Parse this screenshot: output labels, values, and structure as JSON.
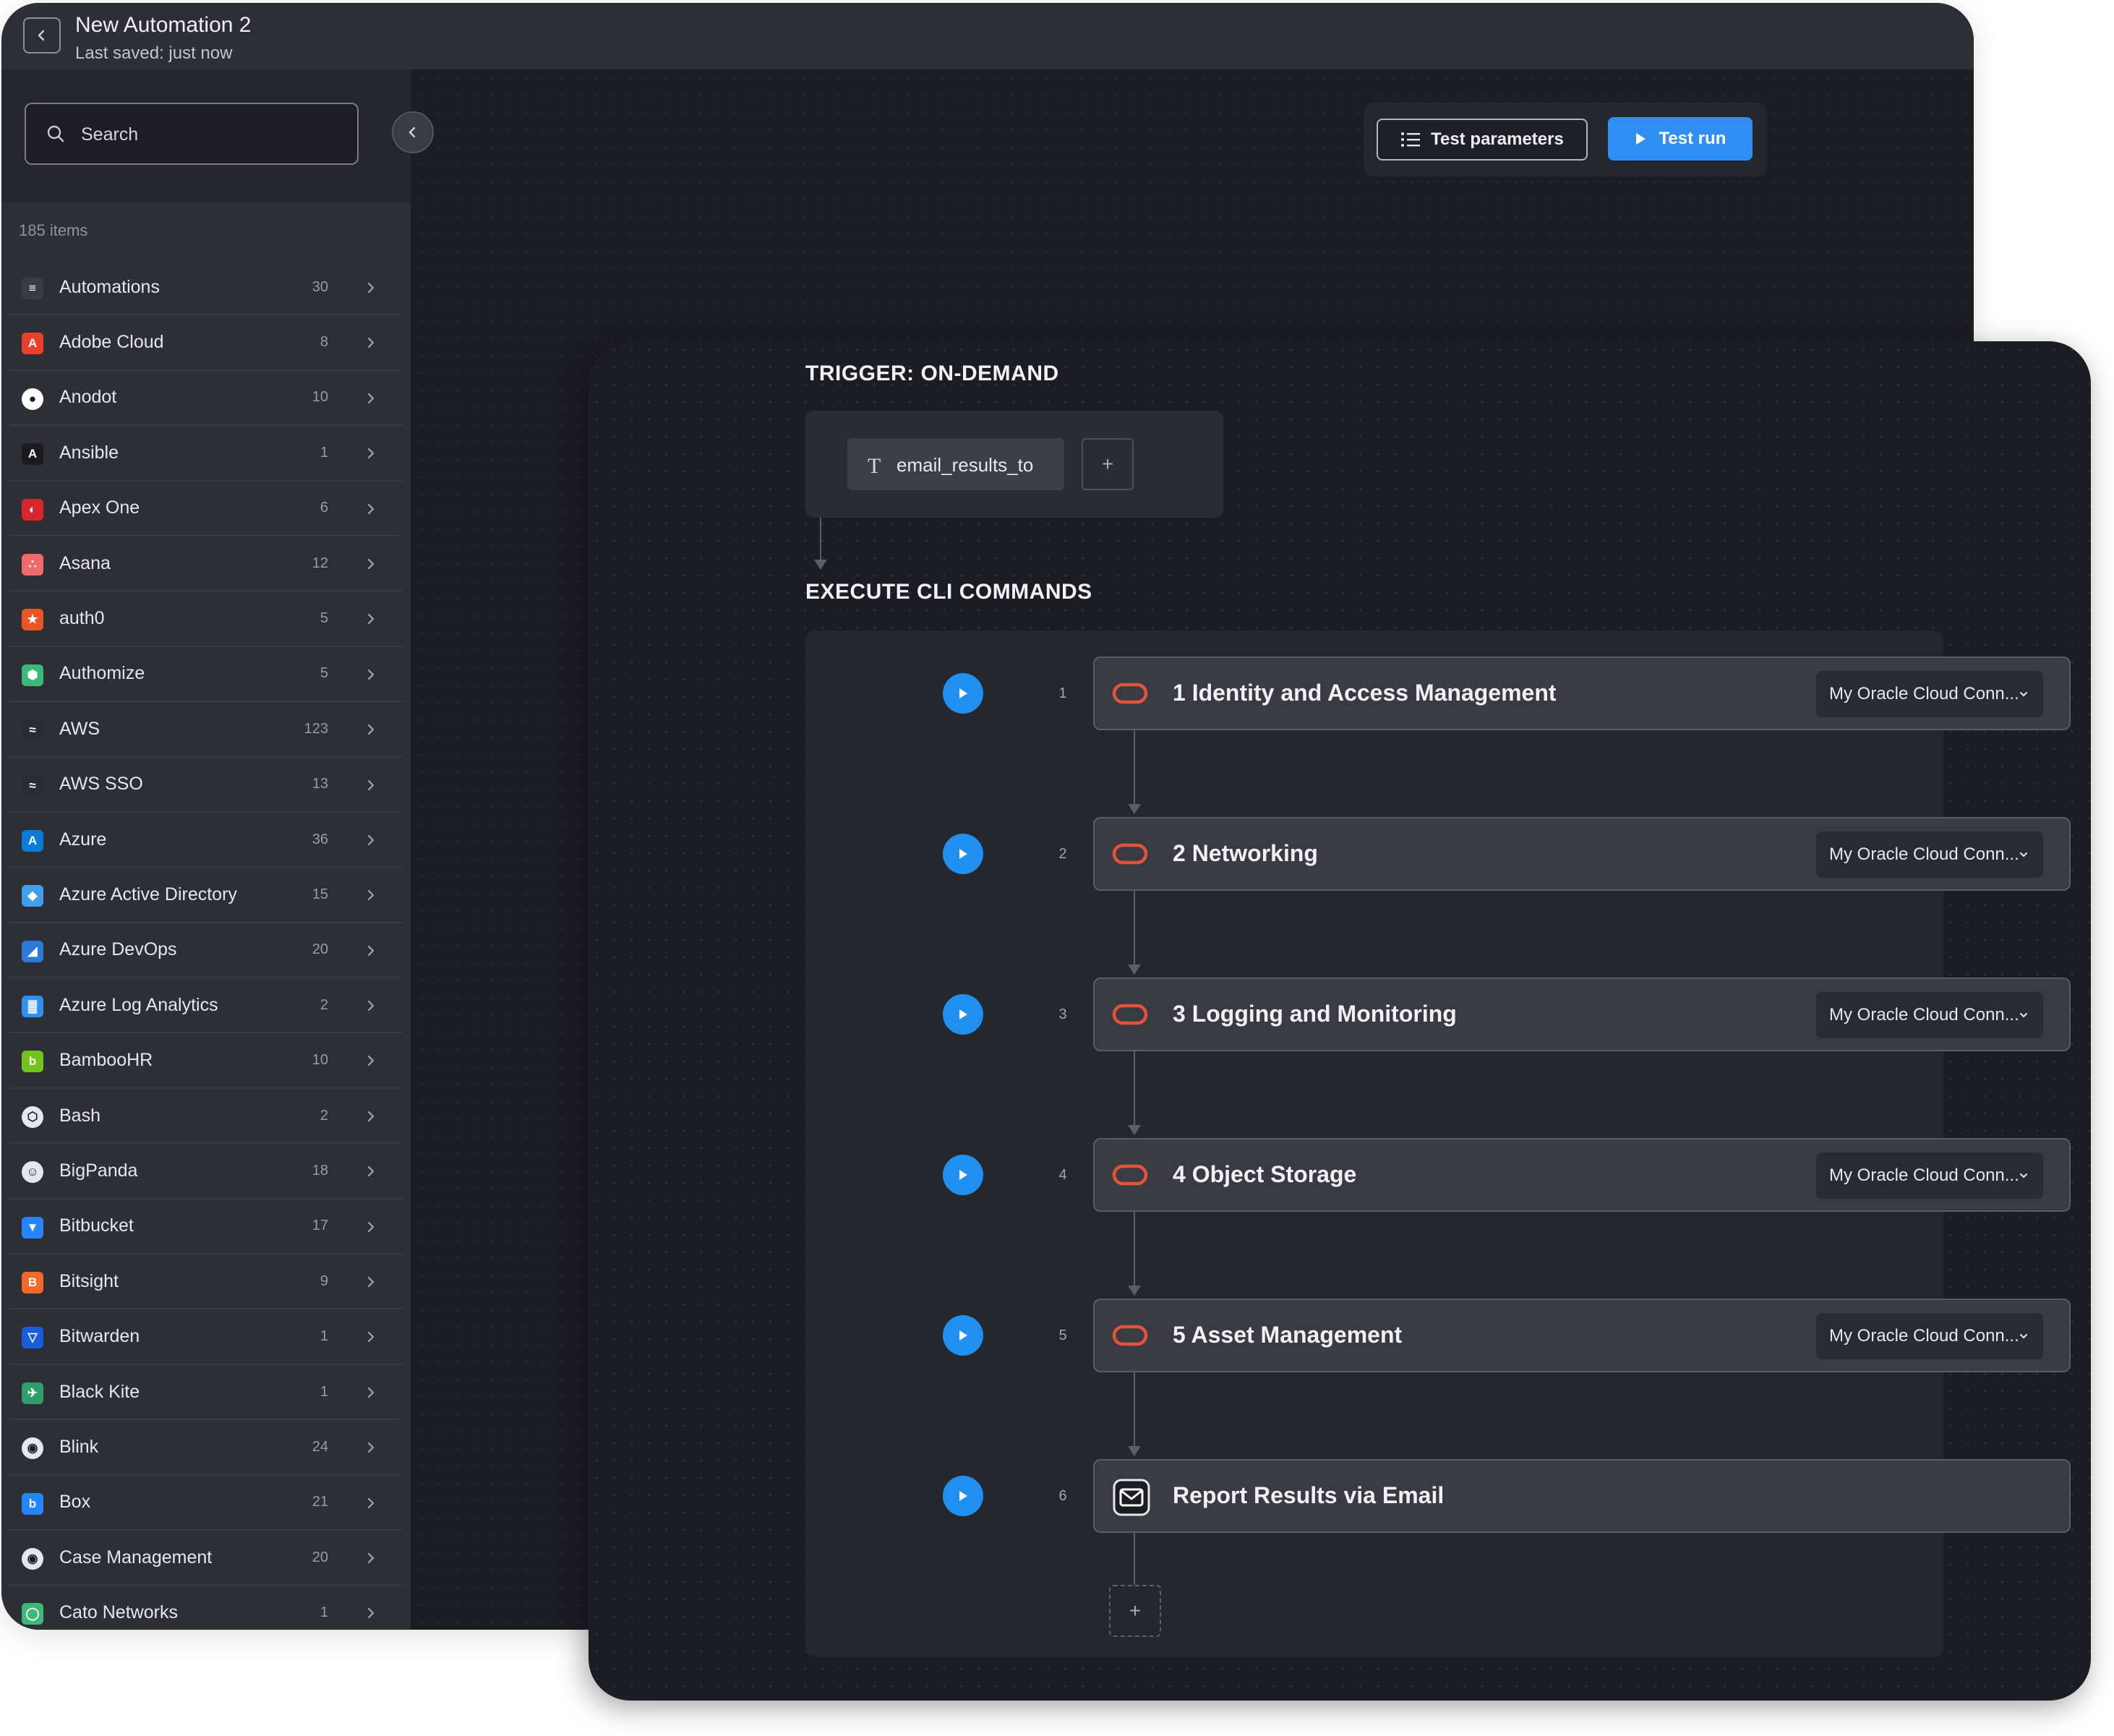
{
  "window": {
    "title": "New Automation 2",
    "save_status": "Last saved: just now"
  },
  "sidebar": {
    "search_placeholder": "Search",
    "items_count": "185 items",
    "items": [
      {
        "label": "Automations",
        "count": "30",
        "icon": "automations-icon",
        "color": "#3a3a42"
      },
      {
        "label": "Adobe Cloud",
        "count": "8",
        "icon": "adobe-cloud-icon",
        "color": "#e8412b"
      },
      {
        "label": "Anodot",
        "count": "10",
        "icon": "anodot-icon",
        "color": "#ffffff"
      },
      {
        "label": "Ansible",
        "count": "1",
        "icon": "ansible-icon",
        "color": "#1b1b1f"
      },
      {
        "label": "Apex One",
        "count": "6",
        "icon": "apex-one-icon",
        "color": "#d8262e"
      },
      {
        "label": "Asana",
        "count": "12",
        "icon": "asana-icon",
        "color": "#f06a6a"
      },
      {
        "label": "auth0",
        "count": "5",
        "icon": "auth0-icon",
        "color": "#eb5424"
      },
      {
        "label": "Authomize",
        "count": "5",
        "icon": "authomize-icon",
        "color": "#3cb878"
      },
      {
        "label": "AWS",
        "count": "123",
        "icon": "aws-icon",
        "color": "#2b2b33"
      },
      {
        "label": "AWS SSO",
        "count": "13",
        "icon": "aws-sso-icon",
        "color": "#2b2b33"
      },
      {
        "label": "Azure",
        "count": "36",
        "icon": "azure-icon",
        "color": "#0a7bd7"
      },
      {
        "label": "Azure Active Directory",
        "count": "15",
        "icon": "azure-active-directory-icon",
        "color": "#3ea0ec"
      },
      {
        "label": "Azure DevOps",
        "count": "20",
        "icon": "azure-devops-icon",
        "color": "#2a7ad8"
      },
      {
        "label": "Azure Log Analytics",
        "count": "2",
        "icon": "azure-log-analytics-icon",
        "color": "#2f8ff2"
      },
      {
        "label": "BambooHR",
        "count": "10",
        "icon": "bamboohr-icon",
        "color": "#73c41d"
      },
      {
        "label": "Bash",
        "count": "2",
        "icon": "bash-icon",
        "color": "#e6e7ec"
      },
      {
        "label": "BigPanda",
        "count": "18",
        "icon": "bigpanda-icon",
        "color": "#e6e7ec"
      },
      {
        "label": "Bitbucket",
        "count": "17",
        "icon": "bitbucket-icon",
        "color": "#2684ff"
      },
      {
        "label": "Bitsight",
        "count": "9",
        "icon": "bitsight-icon",
        "color": "#f26a2a"
      },
      {
        "label": "Bitwarden",
        "count": "1",
        "icon": "bitwarden-icon",
        "color": "#175ddc"
      },
      {
        "label": "Black Kite",
        "count": "1",
        "icon": "black-kite-icon",
        "color": "#2f9e6a"
      },
      {
        "label": "Blink",
        "count": "24",
        "icon": "blink-icon",
        "color": "#e6e7ec"
      },
      {
        "label": "Box",
        "count": "21",
        "icon": "box-icon",
        "color": "#2486fc"
      },
      {
        "label": "Case Management",
        "count": "20",
        "icon": "case-management-icon",
        "color": "#e6e7ec"
      },
      {
        "label": "Cato Networks",
        "count": "1",
        "icon": "cato-networks-icon",
        "color": "#3cb878"
      }
    ]
  },
  "toolbar": {
    "test_parameters_label": "Test parameters",
    "test_run_label": "Test run",
    "accent_color": "#2f8ff2"
  },
  "trigger": {
    "title": "TRIGGER: ON-DEMAND",
    "param_type_icon": "T",
    "param_label": "email_results_to",
    "add_label": "+"
  },
  "execute": {
    "title": "EXECUTE CLI COMMANDS",
    "add_label": "+",
    "steps": [
      {
        "number": "1",
        "title": "1 Identity and Access Management",
        "connection": "My Oracle Cloud Conn...",
        "icon": "oracle-icon"
      },
      {
        "number": "2",
        "title": "2 Networking",
        "connection": "My Oracle Cloud Conn...",
        "icon": "oracle-icon"
      },
      {
        "number": "3",
        "title": "3 Logging and Monitoring",
        "connection": "My Oracle Cloud Conn...",
        "icon": "oracle-icon"
      },
      {
        "number": "4",
        "title": "4 Object Storage",
        "connection": "My Oracle Cloud Conn...",
        "icon": "oracle-icon"
      },
      {
        "number": "5",
        "title": "5 Asset Management",
        "connection": "My Oracle Cloud Conn...",
        "icon": "oracle-icon"
      },
      {
        "number": "6",
        "title": "Report Results via Email",
        "connection": "",
        "icon": "email-icon"
      }
    ]
  }
}
